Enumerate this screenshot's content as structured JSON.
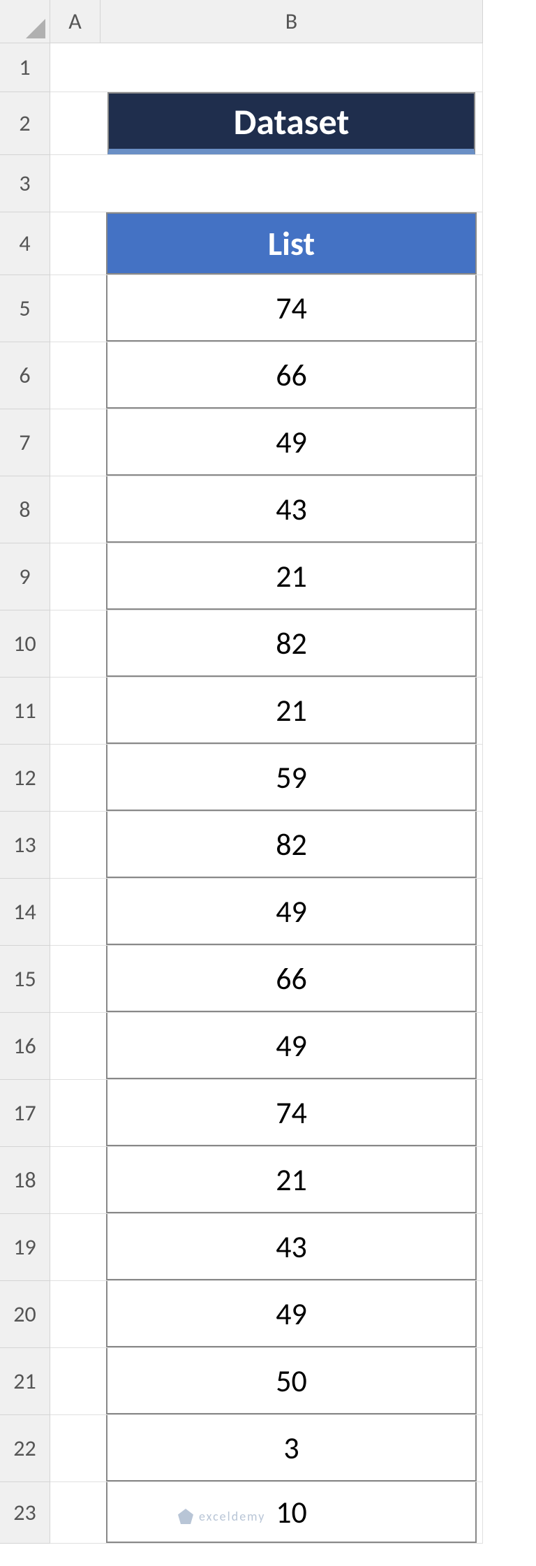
{
  "columns": [
    "A",
    "B"
  ],
  "rows": [
    "1",
    "2",
    "3",
    "4",
    "5",
    "6",
    "7",
    "8",
    "9",
    "10",
    "11",
    "12",
    "13",
    "14",
    "15",
    "16",
    "17",
    "18",
    "19",
    "20",
    "21",
    "22",
    "23"
  ],
  "title": "Dataset",
  "list_header": "List",
  "list_values": [
    "74",
    "66",
    "49",
    "43",
    "21",
    "82",
    "21",
    "59",
    "82",
    "49",
    "66",
    "49",
    "74",
    "21",
    "43",
    "49",
    "50",
    "3",
    "10"
  ],
  "watermark": "exceldemy",
  "chart_data": {
    "type": "table",
    "title": "Dataset",
    "columns": [
      "List"
    ],
    "values": [
      74,
      66,
      49,
      43,
      21,
      82,
      21,
      59,
      82,
      49,
      66,
      49,
      74,
      21,
      43,
      49,
      50,
      3,
      10
    ]
  }
}
